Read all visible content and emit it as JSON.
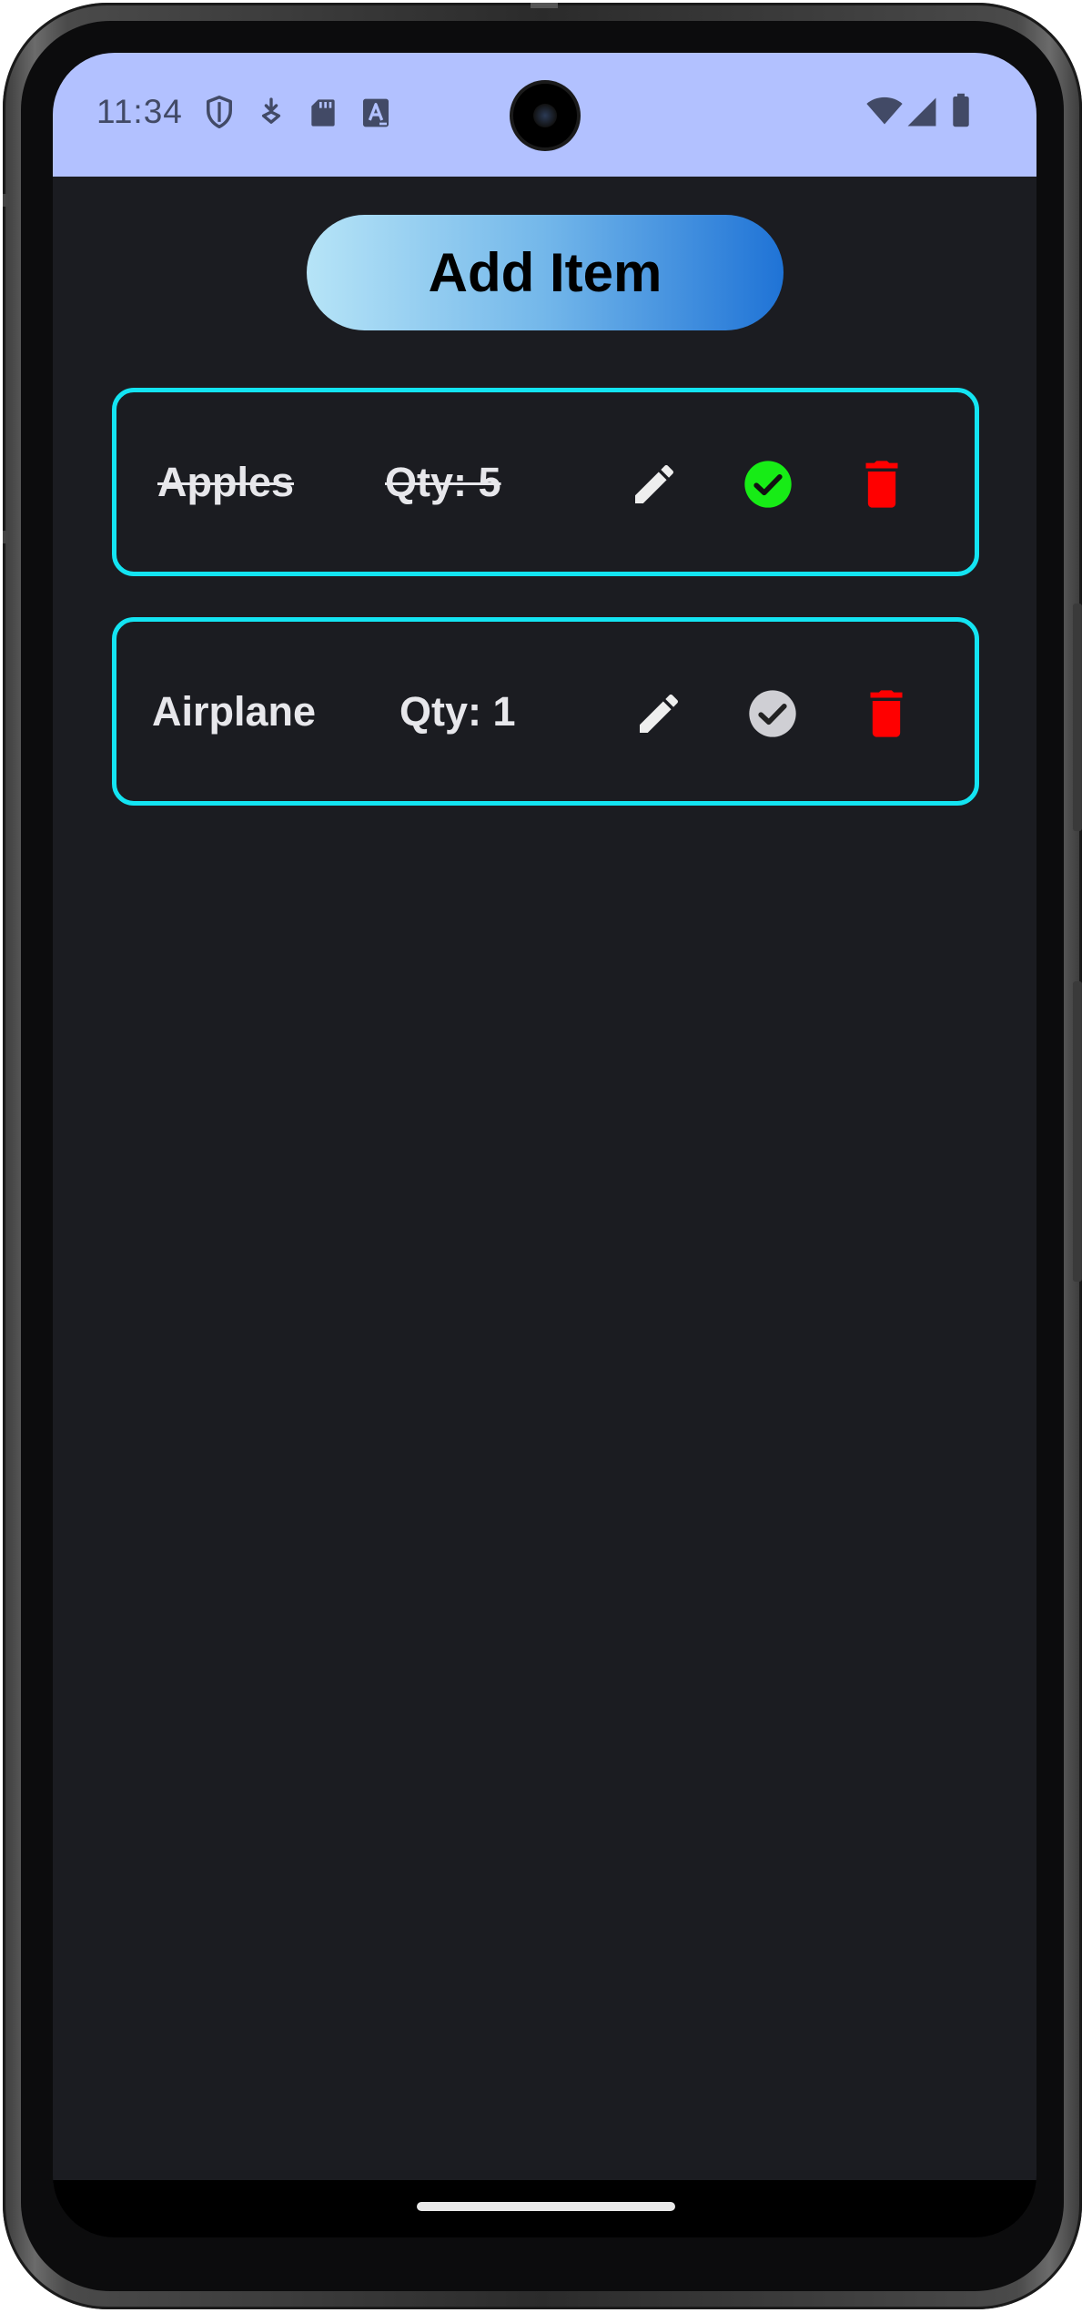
{
  "status_bar": {
    "time": "11:34",
    "background": "#b2c1ff",
    "left_icons": [
      "shield-icon",
      "download-notification-icon",
      "sd-card-icon",
      "font-a-icon"
    ],
    "right_icons": [
      "wifi-icon",
      "signal-icon",
      "battery-icon"
    ]
  },
  "app": {
    "add_button_label": "Add Item",
    "accent_border": "#13e4f2",
    "items": [
      {
        "name": "Apples",
        "qty_label": "Qty: 5",
        "checked": true
      },
      {
        "name": "Airplane",
        "qty_label": "Qty: 1",
        "checked": false
      }
    ],
    "colors": {
      "check_done": "#17ec16",
      "check_pending": "#cfcfd4",
      "delete": "#ff0000",
      "edit": "#eeeeee"
    }
  }
}
